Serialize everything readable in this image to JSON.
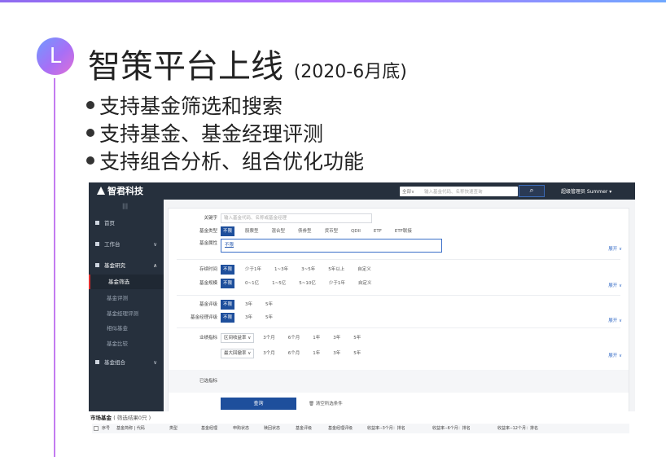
{
  "slide": {
    "badge_letter": "L",
    "title": "智策平台上线",
    "title_sub": "(2020-6月底)",
    "bullets": [
      "支持基金筛选和搜索",
      "支持基金、基金经理评测",
      "支持组合分析、组合优化功能"
    ]
  },
  "app": {
    "logo": "智君科技",
    "search": {
      "scope": "全部∨",
      "placeholder": "输入基金代码、名称快速查询",
      "button_icon": "search-icon"
    },
    "user": "超级管理员  Summer ▾",
    "sidebar": {
      "hamburger": "|||",
      "items": [
        {
          "label": "首页",
          "icon": "home-icon"
        },
        {
          "label": "工作台",
          "icon": "desk-icon",
          "chevron": "∨"
        },
        {
          "label": "基金研究",
          "icon": "research-icon",
          "chevron": "∧"
        },
        {
          "label": "基金筛选"
        },
        {
          "label": "基金评测"
        },
        {
          "label": "基金经理评测"
        },
        {
          "label": "相似基金"
        },
        {
          "label": "基金比较"
        },
        {
          "label": "基金组合",
          "icon": "grid-icon",
          "chevron": "∨"
        }
      ]
    },
    "filters": {
      "keyword_label": "关键字",
      "keyword_placeholder": "输入基金代码、名称或基金经理",
      "fund_type_label": "基金类型",
      "fund_type_options": [
        "不限",
        "股票型",
        "混合型",
        "债券型",
        "货币型",
        "QDII",
        "ETF",
        "ETF联接"
      ],
      "fund_attr_label": "基金属性",
      "fund_attr_value": "不限",
      "expand": "展开 ∨",
      "duration_label": "存续时间",
      "duration_options": [
        "不限",
        "少于1年",
        "1~3年",
        "3~5年",
        "5年以上",
        "自定义"
      ],
      "scale_label": "基金规模",
      "scale_options": [
        "不限",
        "0~1亿",
        "1~5亿",
        "5~10亿",
        "少于1年",
        "自定义"
      ],
      "rating_label": "基金评级",
      "rating_options": [
        "不限",
        "3年",
        "5年"
      ],
      "mgr_rating_label": "基金经理评级",
      "mgr_rating_options": [
        "不限",
        "3年",
        "5年"
      ],
      "perf_label": "业绩指标",
      "perf_select_1": "区间收益率 ∨",
      "perf_select_2": "最大回撤率 ∨",
      "perf_periods": [
        "3个月",
        "6个月",
        "1年",
        "3年",
        "5年"
      ],
      "selected_label": "已选指标",
      "query_button": "查询",
      "clear_button": "清空所选条件"
    },
    "market": {
      "title": "市场基金",
      "count": "( 筛选结果0只 )",
      "columns": [
        "序号",
        "基金简称 | 代码",
        "类型",
        "基金经理",
        "申购状态",
        "赎回状态",
        "基金评级",
        "基金经理评级",
        "收益率--3个月：排名",
        "收益率--6个月：排名",
        "收益率--12个月：排名"
      ]
    }
  }
}
